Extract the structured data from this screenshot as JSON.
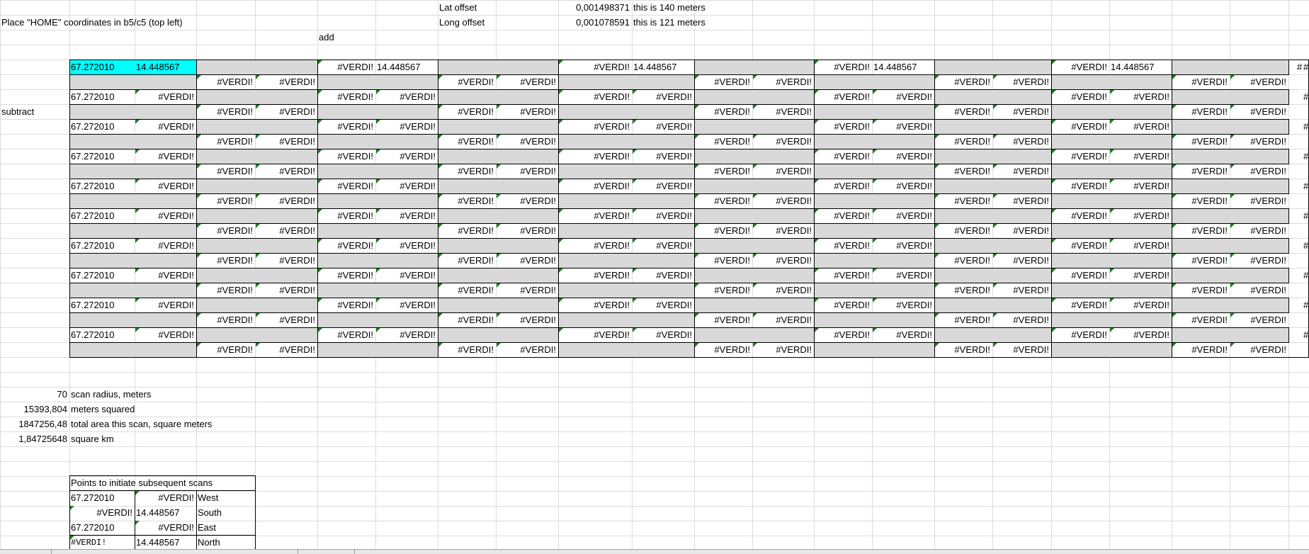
{
  "sheet": {
    "instruction": "Place \"HOME\" coordinates in b5/c5 (top left)",
    "add_label": "add",
    "subtract_label": "subtract",
    "lat_offset_label": "Lat offset",
    "long_offset_label": "Long offset",
    "lat_offset_value": "0,001498371",
    "long_offset_value": "0,001078591",
    "lat_offset_note": "this is 140 meters",
    "long_offset_note": "this is 121 meters",
    "home_lat": "67.272010",
    "home_long": "14.448567",
    "error": "#VERDI!",
    "scan_radius_value": "70",
    "scan_radius_label": "scan radius, meters",
    "meters_squared_value": "15393,804",
    "meters_squared_label": "meters squared",
    "total_area_value": "1847256,48",
    "total_area_label": "total area this scan, square meters",
    "square_km_value": "1,84725648",
    "square_km_label": "square km",
    "points_title": "Points to initiate subsequent scans",
    "points": [
      {
        "a": "67.272010",
        "b": "#VERDI!",
        "dir": "West"
      },
      {
        "a": "#VERDI!",
        "b": "14.448567",
        "dir": "South"
      },
      {
        "a": "67.272010",
        "b": "#VERDI!",
        "dir": "East"
      },
      {
        "a": "#VERDI!",
        "b": "14.448567",
        "dir": "North"
      }
    ],
    "overflow_glyph": "#"
  }
}
